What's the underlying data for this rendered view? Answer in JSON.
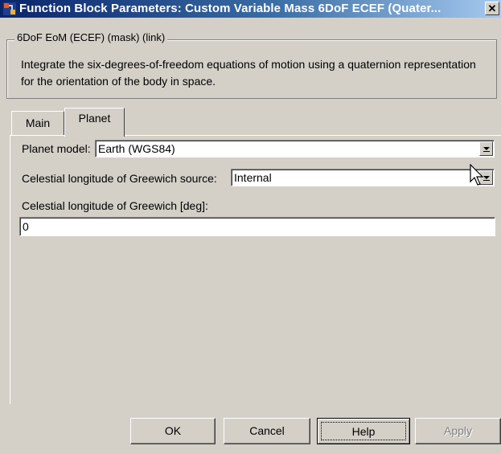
{
  "window": {
    "title": "Function Block Parameters: Custom Variable Mass 6DoF ECEF (Quater...",
    "close_glyph": "✕"
  },
  "group": {
    "legend": "6DoF EoM (ECEF) (mask) (link)",
    "description": "Integrate the six-degrees-of-freedom equations of motion using a quaternion representation for the orientation of the body in space."
  },
  "tabs": [
    {
      "label": "Main",
      "active": false
    },
    {
      "label": "Planet",
      "active": true
    }
  ],
  "planet": {
    "planet_model_label": "Planet model:",
    "planet_model_value": "Earth (WGS84)",
    "greenwich_source_label": "Celestial longitude of Greewich source:",
    "greenwich_source_value": "Internal",
    "greenwich_deg_label": "Celestial longitude of Greewich [deg]:",
    "greenwich_deg_value": "0"
  },
  "buttons": {
    "ok": "OK",
    "cancel": "Cancel",
    "help": "Help",
    "apply": "Apply"
  },
  "icons": {
    "app": "simulink-block-icon",
    "close": "close-icon",
    "dropdown": "chevron-down-icon",
    "cursor": "mouse-pointer-icon"
  },
  "colors": {
    "title_bar_start": "#0a246a",
    "title_bar_end": "#a6caf0",
    "dialog_bg": "#d4d0c8"
  }
}
